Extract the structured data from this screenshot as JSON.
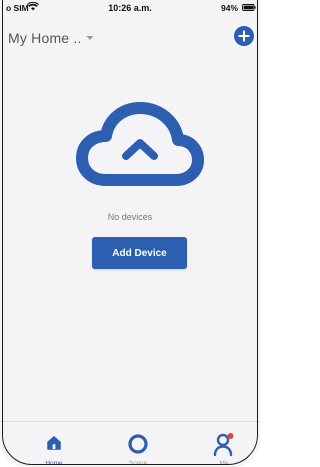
{
  "status_bar": {
    "carrier": "o SIM",
    "time": "10:26 a.m.",
    "battery": "94%"
  },
  "header": {
    "home_selector_label": "My Home .."
  },
  "empty_state": {
    "message": "No devices",
    "button_label": "Add Device"
  },
  "tabs": [
    {
      "label": "Home",
      "icon": "home-icon",
      "active": true
    },
    {
      "label": "Scene",
      "icon": "scene-ring-icon",
      "active": false
    },
    {
      "label": "Me",
      "icon": "user-icon",
      "active": false
    }
  ],
  "colors": {
    "accent": "#2c5fb0",
    "notification_dot": "#e0473a",
    "background": "#f4f4f6",
    "inactive_tab": "#9a9a9a"
  }
}
